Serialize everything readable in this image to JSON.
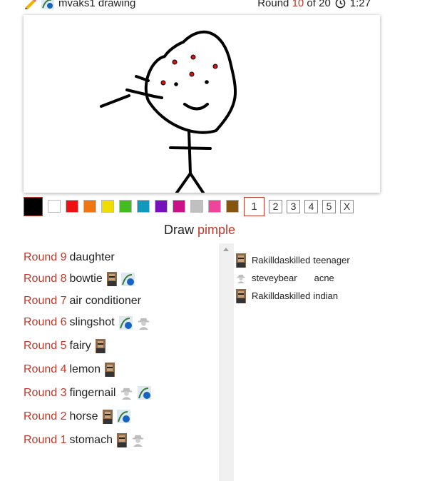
{
  "header": {
    "drawer": "mvaks1 drawing",
    "round_label": "Round",
    "round_current": "10",
    "round_of": "of 20",
    "timer": "1:27"
  },
  "palette": {
    "colors": [
      "#000000",
      "#ffffff",
      "#ee1111",
      "#ee7711",
      "#eedd00",
      "#44bb22",
      "#1199bb",
      "#7711bb",
      "#cc1188",
      "#c0c0c0",
      "#ee4499",
      "#885511"
    ],
    "brush_sizes": [
      "1",
      "2",
      "3",
      "4",
      "5"
    ],
    "clear_label": "X"
  },
  "prompt": {
    "label": "Draw",
    "word": "pimple"
  },
  "history": [
    {
      "round": "Round 9",
      "word": "daughter",
      "avatars": []
    },
    {
      "round": "Round 8",
      "word": "bowtie",
      "avatars": [
        "man",
        "bird"
      ]
    },
    {
      "round": "Round 7",
      "word": "air conditioner",
      "avatars": []
    },
    {
      "round": "Round 6",
      "word": "slingshot",
      "avatars": [
        "bird",
        "spy"
      ]
    },
    {
      "round": "Round 5",
      "word": "fairy",
      "avatars": [
        "man"
      ]
    },
    {
      "round": "Round 4",
      "word": "lemon",
      "avatars": [
        "man"
      ]
    },
    {
      "round": "Round 3",
      "word": "fingernail",
      "avatars": [
        "spy",
        "bird"
      ]
    },
    {
      "round": "Round 2",
      "word": "horse",
      "avatars": [
        "man",
        "bird"
      ]
    },
    {
      "round": "Round 1",
      "word": "stomach",
      "avatars": [
        "man",
        "spy"
      ]
    }
  ],
  "chat": [
    {
      "name": "Rakilldaskilled",
      "message": "teenager",
      "avatar": "man"
    },
    {
      "name": "steveybear",
      "message": "acne",
      "avatar": "spy"
    },
    {
      "name": "Rakilldaskilled",
      "message": "indian",
      "avatar": "man"
    }
  ]
}
